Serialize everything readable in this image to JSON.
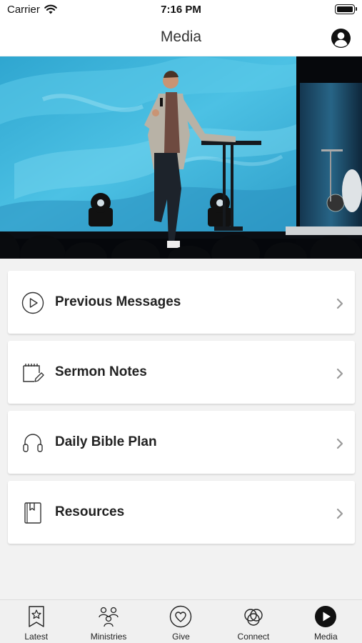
{
  "status": {
    "carrier": "Carrier",
    "time": "7:16 PM"
  },
  "header": {
    "title": "Media"
  },
  "menu": [
    {
      "label": "Previous Messages",
      "icon": "play-circle-icon"
    },
    {
      "label": "Sermon Notes",
      "icon": "notepad-pencil-icon"
    },
    {
      "label": "Daily Bible Plan",
      "icon": "headphones-icon"
    },
    {
      "label": "Resources",
      "icon": "bookmark-book-icon"
    }
  ],
  "tabs": [
    {
      "label": "Latest",
      "icon": "bookmark-star-icon",
      "active": false
    },
    {
      "label": "Ministries",
      "icon": "people-group-icon",
      "active": false
    },
    {
      "label": "Give",
      "icon": "heart-circle-icon",
      "active": false
    },
    {
      "label": "Connect",
      "icon": "circles-icon",
      "active": false
    },
    {
      "label": "Media",
      "icon": "play-filled-icon",
      "active": true
    }
  ],
  "colors": {
    "accent": "#111111",
    "background": "#f2f2f2",
    "card": "#ffffff",
    "hero_blue": "#3fb6dd"
  }
}
